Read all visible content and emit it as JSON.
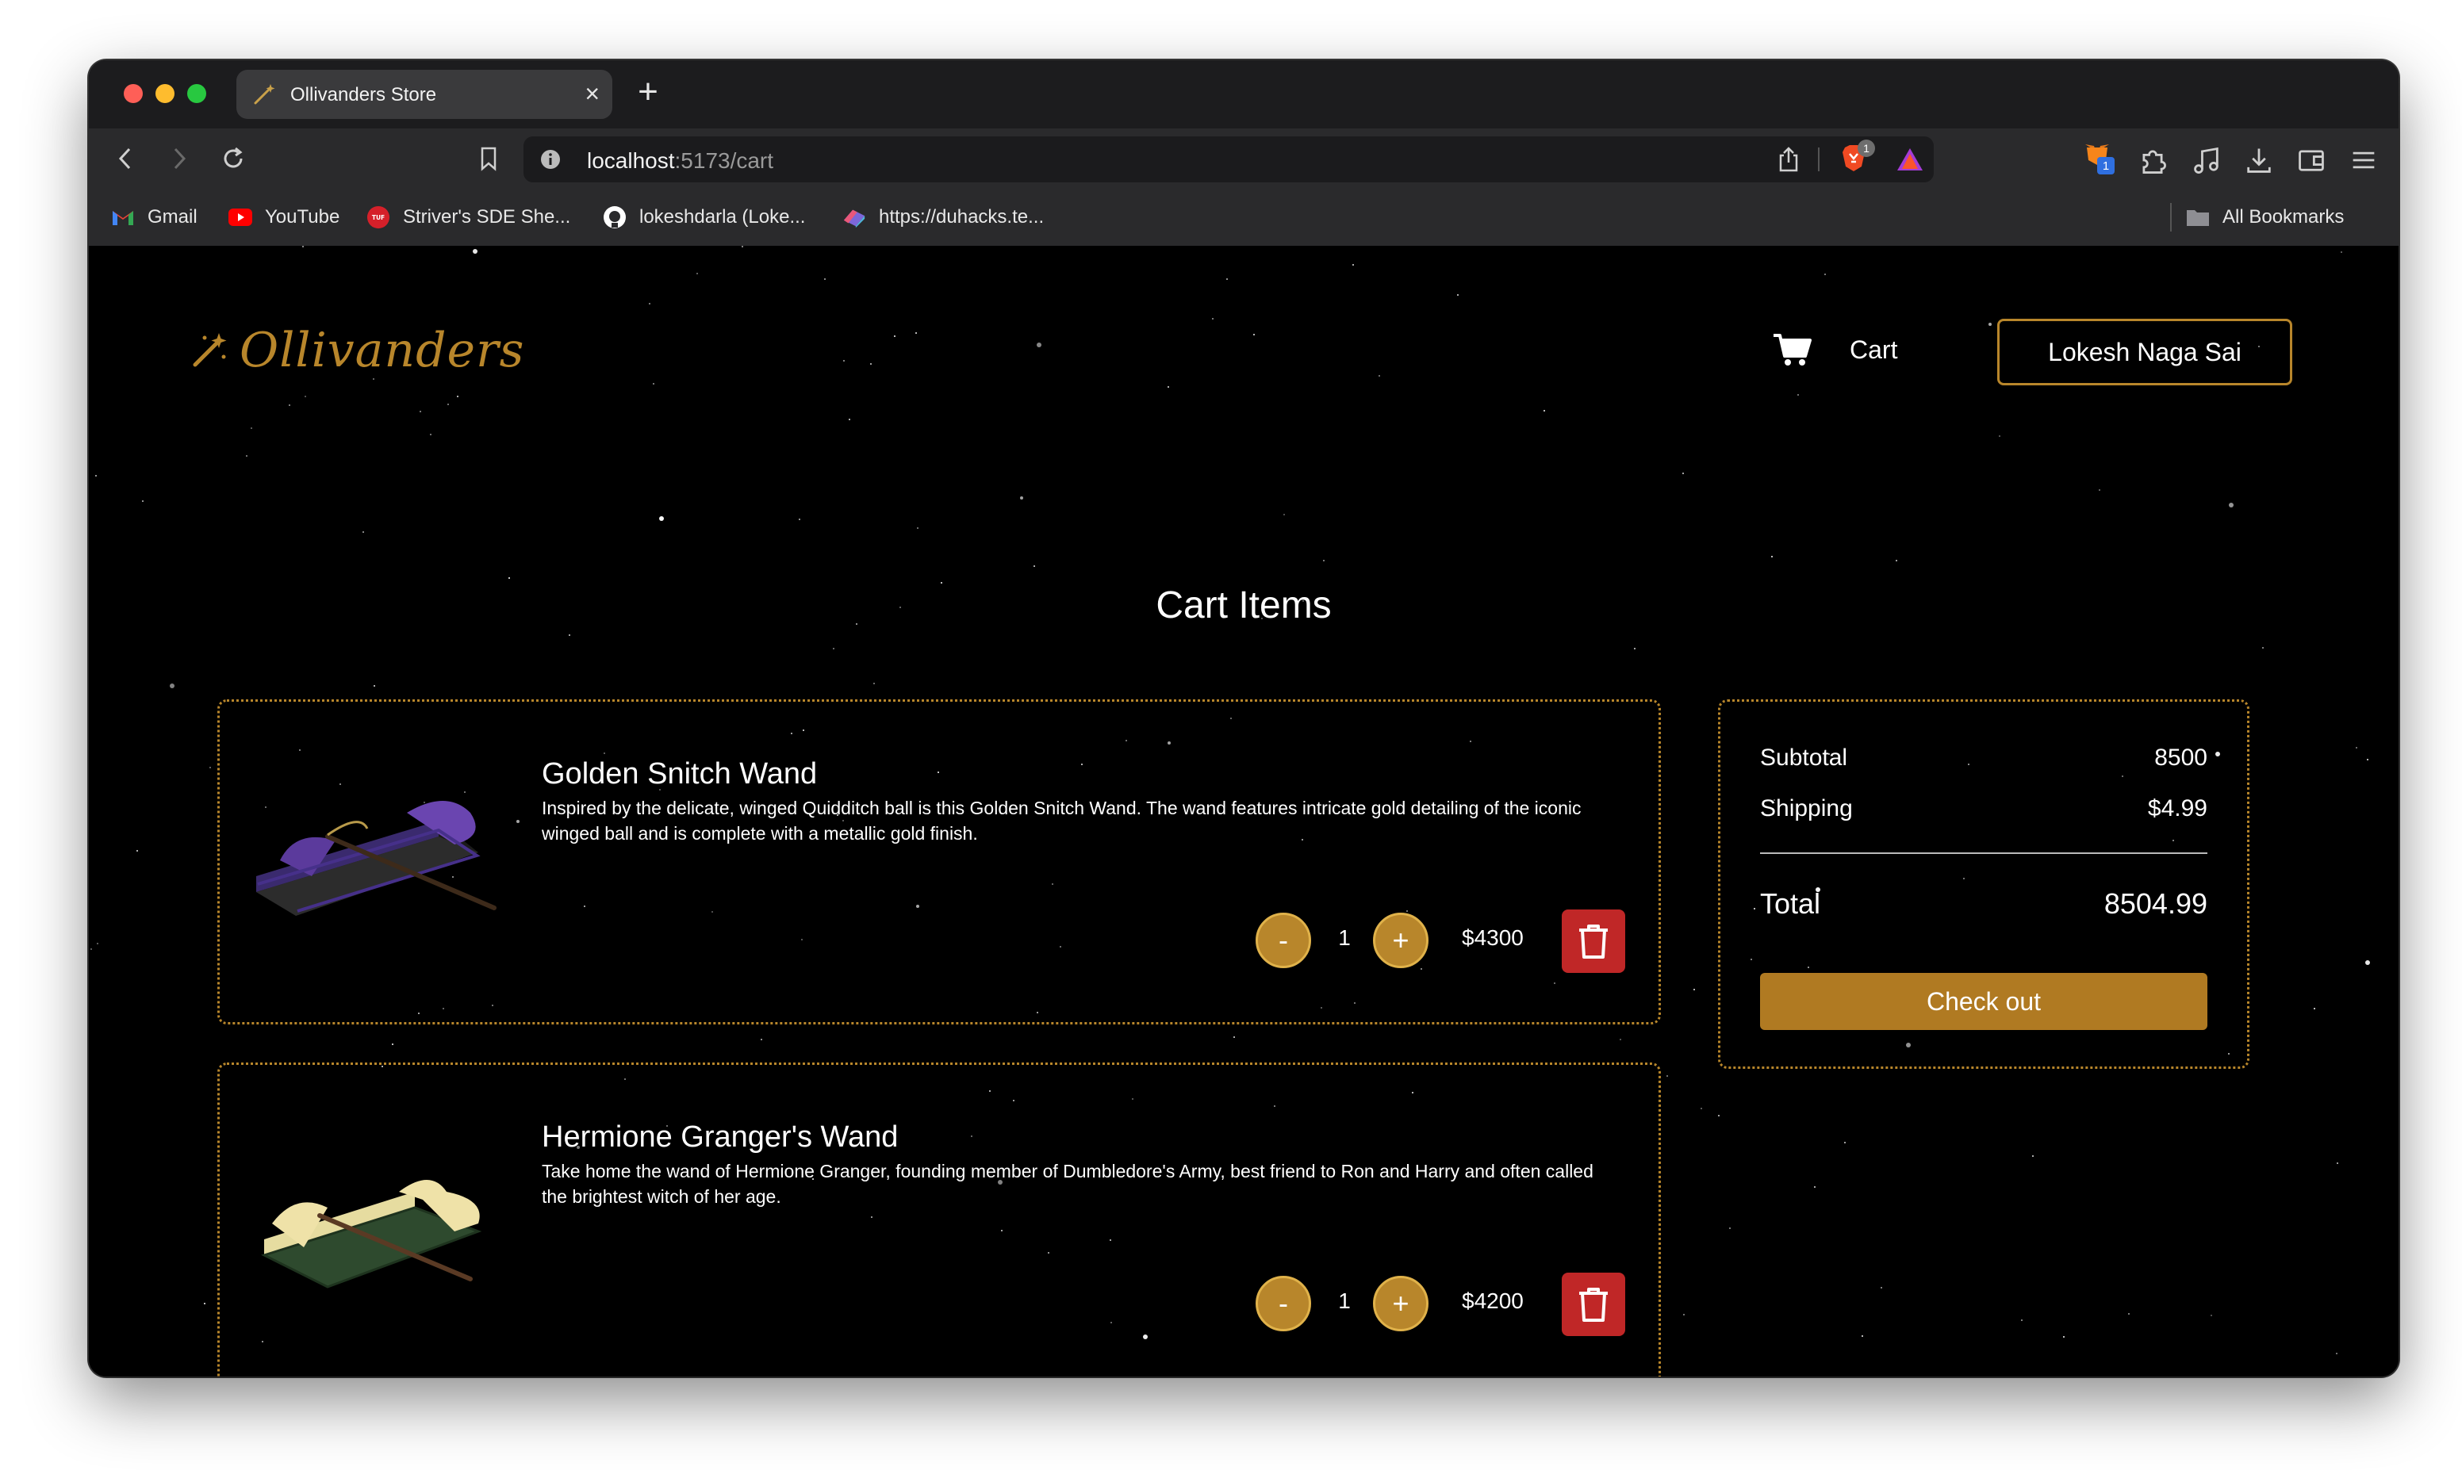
{
  "browser": {
    "tab_title": "Ollivanders Store",
    "new_tab_symbol": "+",
    "close_symbol": "×",
    "url_host": "localhost",
    "url_path": ":5173/cart",
    "shield_badge": "1",
    "wallet_badge": "1"
  },
  "bookmarks": {
    "items": [
      {
        "label": "Gmail",
        "icon": "gmail-icon"
      },
      {
        "label": "YouTube",
        "icon": "youtube-icon"
      },
      {
        "label": "Striver's SDE She...",
        "icon": "tuf-icon"
      },
      {
        "label": "lokeshdarla (Loke...",
        "icon": "github-icon"
      },
      {
        "label": "https://duhacks.te...",
        "icon": "link-icon"
      }
    ],
    "all_bookmarks": "All Bookmarks"
  },
  "header": {
    "logo": "Ollivanders",
    "cart_label": "Cart",
    "user_name": "Lokesh Naga Sai"
  },
  "page": {
    "title": "Cart Items"
  },
  "items": [
    {
      "name": "Golden Snitch Wand",
      "description": "Inspired by the delicate, winged Quidditch ball is this Golden Snitch Wand. The wand features intricate gold detailing of the iconic winged ball and is complete with a metallic gold finish.",
      "quantity": "1",
      "price": "$4300",
      "minus": "-",
      "plus": "+"
    },
    {
      "name": "Hermione Granger's Wand",
      "description": "Take home the wand of Hermione Granger, founding member of Dumbledore's Army, best friend to Ron and Harry and often called the brightest witch of her age.",
      "quantity": "1",
      "price": "$4200",
      "minus": "-",
      "plus": "+"
    }
  ],
  "summary": {
    "subtotal_label": "Subtotal",
    "subtotal_value": "8500",
    "shipping_label": "Shipping",
    "shipping_value": "$4.99",
    "total_label": "Total",
    "total_value": "8504.99",
    "checkout_label": "Check out"
  },
  "colors": {
    "accent_gold": "#b8862b",
    "delete_red": "#c02727",
    "background": "#000000"
  }
}
